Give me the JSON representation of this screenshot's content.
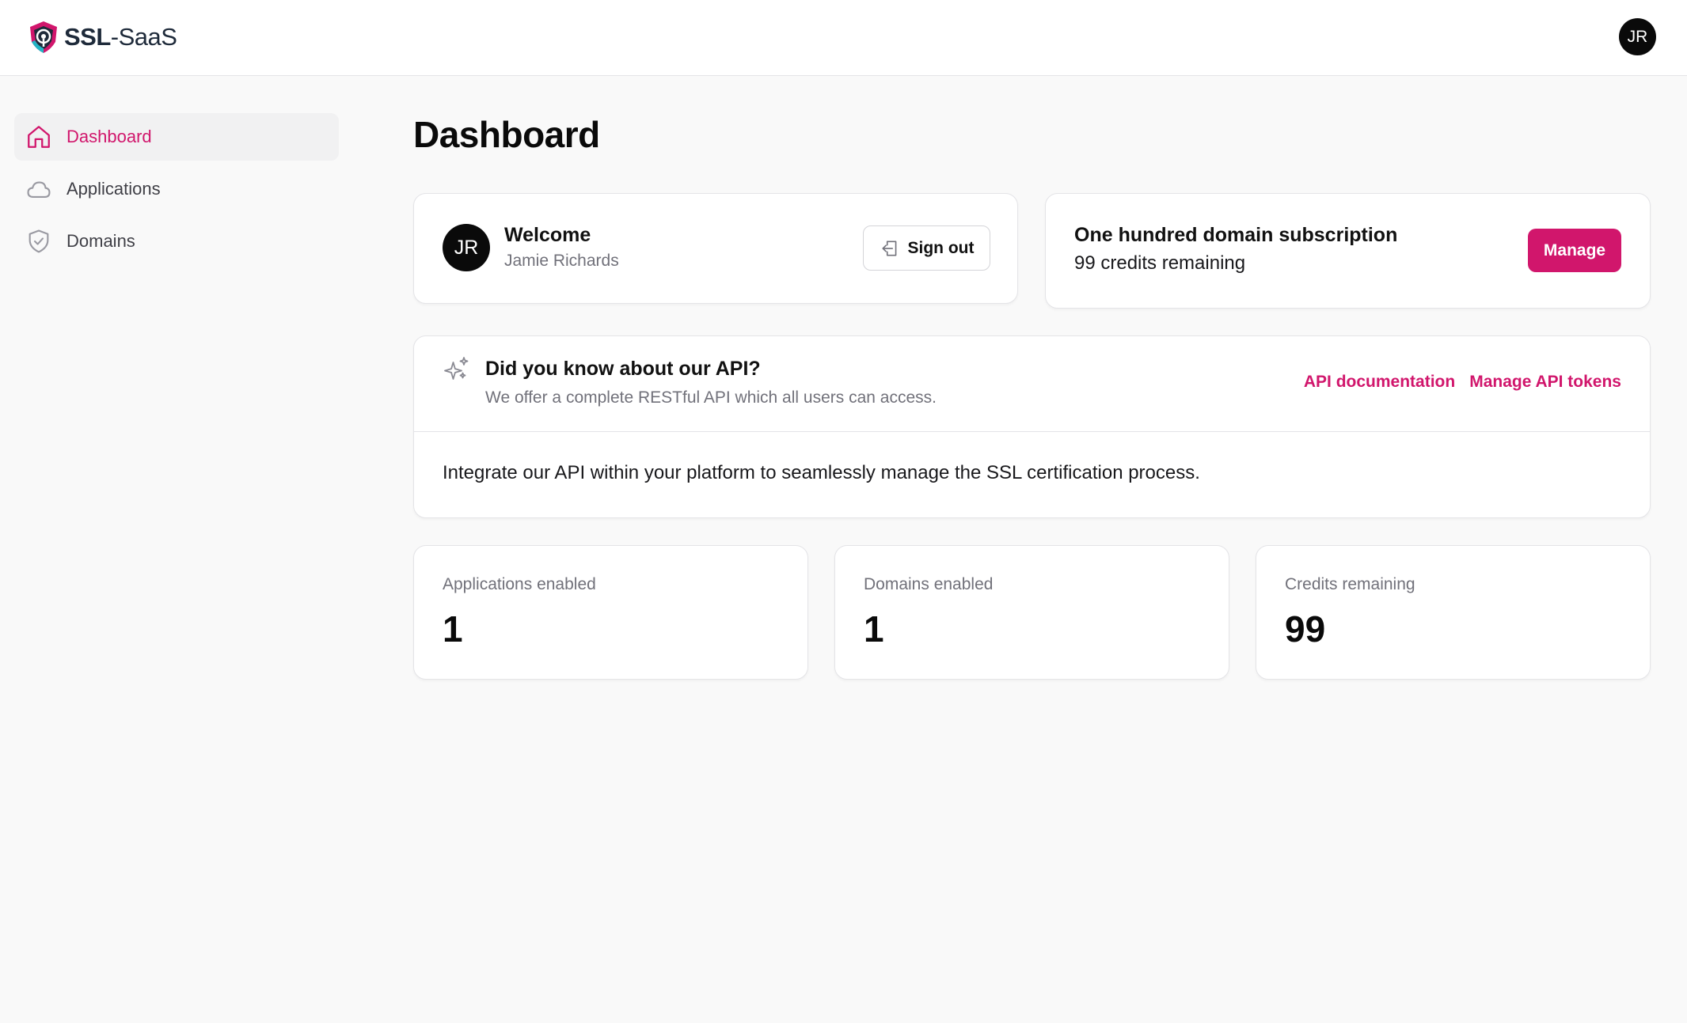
{
  "header": {
    "logo_bold": "SSL",
    "logo_regular": "-SaaS",
    "user_initials": "JR"
  },
  "sidebar": {
    "items": [
      {
        "label": "Dashboard",
        "icon": "home-icon",
        "active": true
      },
      {
        "label": "Applications",
        "icon": "cloud-icon",
        "active": false
      },
      {
        "label": "Domains",
        "icon": "shield-check-icon",
        "active": false
      }
    ]
  },
  "main": {
    "title": "Dashboard",
    "welcome": {
      "initials": "JR",
      "title": "Welcome",
      "name": "Jamie Richards",
      "signout_label": "Sign out"
    },
    "subscription": {
      "title": "One hundred domain subscription",
      "credits_text": "99 credits remaining",
      "manage_label": "Manage"
    },
    "api": {
      "title": "Did you know about our API?",
      "description": "We offer a complete RESTful API which all users can access.",
      "link_docs": "API documentation",
      "link_tokens": "Manage API tokens",
      "body": "Integrate our API within your platform to seamlessly manage the SSL certification process."
    },
    "stats": [
      {
        "label": "Applications enabled",
        "value": "1"
      },
      {
        "label": "Domains enabled",
        "value": "1"
      },
      {
        "label": "Credits remaining",
        "value": "99"
      }
    ]
  },
  "colors": {
    "accent": "#d1166c",
    "background": "#f9f9f9",
    "card": "#ffffff",
    "border": "#e4e4e7",
    "muted_text": "#71717a"
  }
}
